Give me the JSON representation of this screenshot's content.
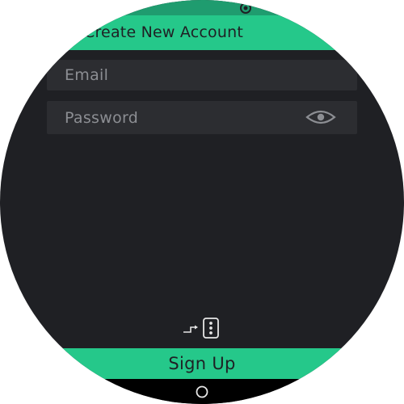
{
  "status_bar": {
    "icon": "circle-dot-icon"
  },
  "header": {
    "title": "Create New Account"
  },
  "form": {
    "email": {
      "value": "",
      "placeholder": "Email"
    },
    "password": {
      "value": "",
      "placeholder": "Password",
      "toggle_icon": "eye-icon"
    }
  },
  "switch_icon": "qr-switch-icon",
  "signup": {
    "label": "Sign Up"
  },
  "nav": {
    "home_icon": "circle-home-icon"
  },
  "colors": {
    "accent": "#25c88a",
    "status_bar": "#1f9c6f",
    "background": "#1f2024",
    "field": "#2c2d31",
    "placeholder": "#8c8e93",
    "nav_bar": "#000000"
  }
}
